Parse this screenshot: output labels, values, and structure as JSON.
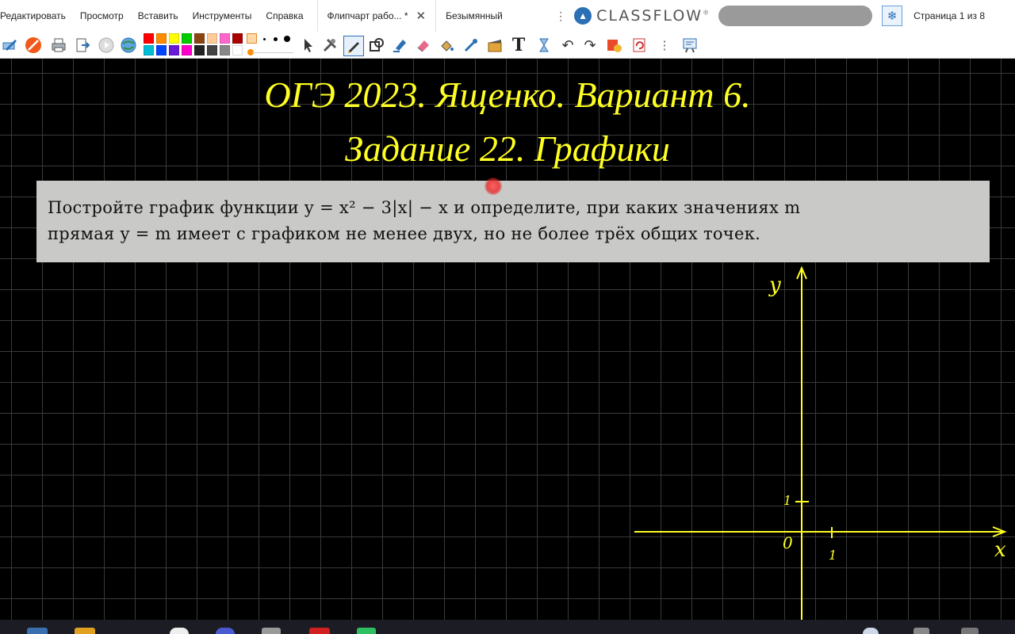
{
  "menu": {
    "items": [
      "Редактировать",
      "Просмотр",
      "Вставить",
      "Инструменты",
      "Справка"
    ]
  },
  "tabs": [
    {
      "label": "Флипчарт рабо... *",
      "active": true
    },
    {
      "label": "Безымянный",
      "active": false
    }
  ],
  "brand": {
    "name": "CLASSFLOW",
    "mark": "®"
  },
  "page_indicator": "Страница 1 из 8",
  "toolbar": {
    "palette_top": [
      "#ff0000",
      "#ff8c00",
      "#ffff00",
      "#00cc00",
      "#00aa88",
      "#8b4513",
      "#ffcc99",
      "#ff66cc",
      "#cc99ff",
      "#aa0000"
    ],
    "palette_bottom": [
      "#00bcd4",
      "#0044ff",
      "#6a1bd8",
      "#ff00cc",
      "#222222",
      "#444444",
      "#888888",
      "#ffffff"
    ],
    "accent_color": "#ff8c00",
    "icons": [
      "pencil-settings-icon",
      "no-entry-icon",
      "print-icon",
      "export-icon",
      "play-icon",
      "globe-icon",
      "arrow-pointer-icon",
      "tools-icon",
      "pen-icon",
      "shapes-icon",
      "highlighter-icon",
      "eraser-icon",
      "fill-icon",
      "pipette-icon",
      "media-icon",
      "text-icon",
      "hourglass-icon",
      "undo-icon",
      "redo-icon",
      "add-page-icon",
      "reset-page-icon",
      "menu-icon",
      "flipchart-icon"
    ]
  },
  "canvas": {
    "title_line1": "ОГЭ 2023. Ященко. Вариант 6.",
    "title_line2": "Задание 22. Графики",
    "title_color": "#ffff22",
    "task_line1": "Постройте график функции y = x² − 3|x| − x и определите, при каких значениях m",
    "task_line2": "прямая y = m имеет с графиком не менее двух, но не более трёх общих точек.",
    "graph": {
      "y_label": "y",
      "x_label": "x",
      "origin_label": "0",
      "unit_y_label": "1",
      "unit_x_label": "1",
      "line_color": "#ffff22"
    }
  }
}
